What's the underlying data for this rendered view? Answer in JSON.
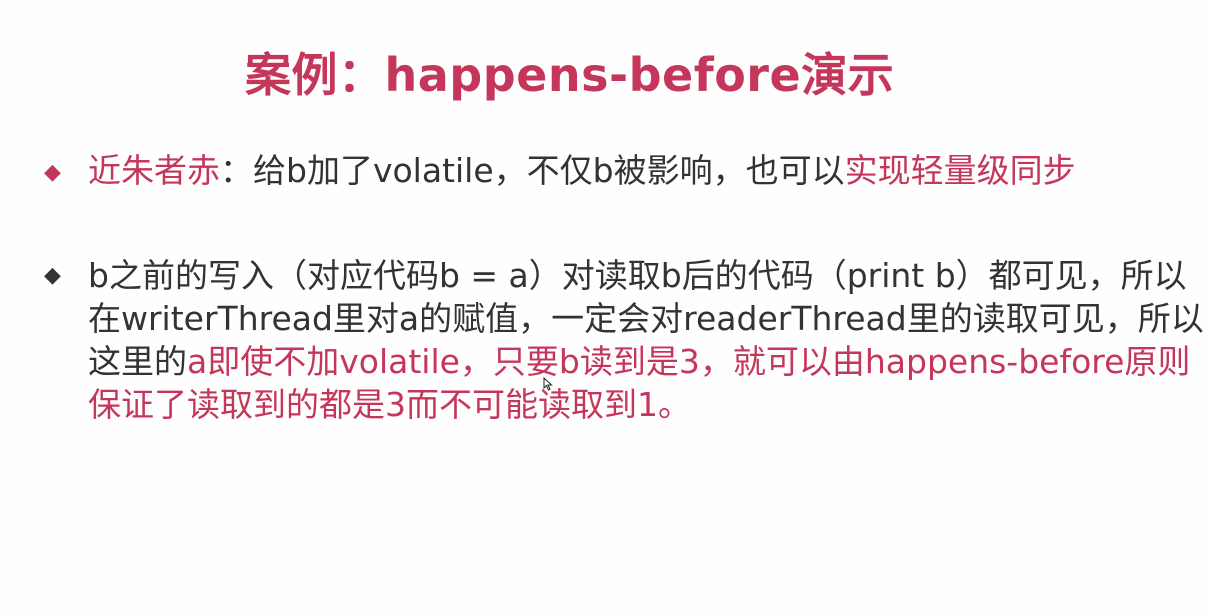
{
  "title": "案例：happens-before演示",
  "bullets": [
    {
      "marker": "◆",
      "part1": "近朱者赤",
      "part2": "：给b加了volatile，不仅b被影响，也可以",
      "part3": "实现轻量级同步"
    },
    {
      "marker": "◆",
      "part1": "b之前的写入（对应代码b = a）对读取b后的代码（print b）都可见，所以在writerThread里对a的赋值，一定会对readerThread里的读取可见，所以这里的",
      "part2": "a即使不加volatile，只要b读到是3，就可以由happens-before原则保证了读取到的都是3而不可能读取到1。"
    }
  ],
  "colors": {
    "accent": "#c5375a",
    "text": "#333333",
    "background": "#ffffff"
  },
  "icons": {
    "bullet": "diamond-bullet-icon",
    "cursor": "mouse-pointer-icon"
  }
}
